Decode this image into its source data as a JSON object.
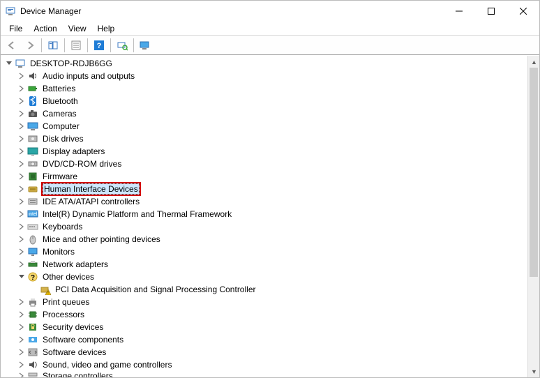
{
  "window": {
    "title": "Device Manager"
  },
  "menubar": [
    "File",
    "Action",
    "View",
    "Help"
  ],
  "tree": {
    "root": "DESKTOP-RDJB6GG",
    "categories": [
      {
        "label": "Audio inputs and outputs",
        "exp": ">",
        "icon": "speaker"
      },
      {
        "label": "Batteries",
        "exp": ">",
        "icon": "battery"
      },
      {
        "label": "Bluetooth",
        "exp": ">",
        "icon": "bluetooth"
      },
      {
        "label": "Cameras",
        "exp": ">",
        "icon": "camera"
      },
      {
        "label": "Computer",
        "exp": ">",
        "icon": "computer"
      },
      {
        "label": "Disk drives",
        "exp": ">",
        "icon": "disk"
      },
      {
        "label": "Display adapters",
        "exp": ">",
        "icon": "display"
      },
      {
        "label": "DVD/CD-ROM drives",
        "exp": ">",
        "icon": "dvd"
      },
      {
        "label": "Firmware",
        "exp": ">",
        "icon": "firmware"
      },
      {
        "label": "Human Interface Devices",
        "exp": ">",
        "icon": "hid",
        "highlight": true,
        "selected": true
      },
      {
        "label": "IDE ATA/ATAPI controllers",
        "exp": ">",
        "icon": "ide"
      },
      {
        "label": "Intel(R) Dynamic Platform and Thermal Framework",
        "exp": ">",
        "icon": "thermal"
      },
      {
        "label": "Keyboards",
        "exp": ">",
        "icon": "keyboard"
      },
      {
        "label": "Mice and other pointing devices",
        "exp": ">",
        "icon": "mouse"
      },
      {
        "label": "Monitors",
        "exp": ">",
        "icon": "monitor"
      },
      {
        "label": "Network adapters",
        "exp": ">",
        "icon": "network"
      },
      {
        "label": "Other devices",
        "exp": "v",
        "icon": "other",
        "children": [
          {
            "label": "PCI Data Acquisition and Signal Processing Controller",
            "icon": "warn"
          }
        ]
      },
      {
        "label": "Print queues",
        "exp": ">",
        "icon": "printer"
      },
      {
        "label": "Processors",
        "exp": ">",
        "icon": "cpu"
      },
      {
        "label": "Security devices",
        "exp": ">",
        "icon": "security"
      },
      {
        "label": "Software components",
        "exp": ">",
        "icon": "softcomp"
      },
      {
        "label": "Software devices",
        "exp": ">",
        "icon": "softdev"
      },
      {
        "label": "Sound, video and game controllers",
        "exp": ">",
        "icon": "sound"
      },
      {
        "label": "Storage controllers",
        "exp": ">",
        "icon": "storage",
        "cut": true
      }
    ]
  }
}
